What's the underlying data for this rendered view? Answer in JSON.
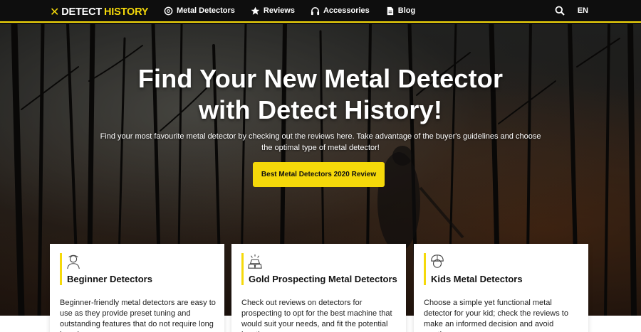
{
  "nav": {
    "logo_word1": "DETECT",
    "logo_word2": "HISTORY",
    "items": [
      {
        "label": "Metal Detectors",
        "icon": "metal-detector-icon"
      },
      {
        "label": "Reviews",
        "icon": "star-icon"
      },
      {
        "label": "Accessories",
        "icon": "headphones-icon"
      },
      {
        "label": "Blog",
        "icon": "document-icon"
      }
    ],
    "lang": "EN",
    "accent": "#f5d90a"
  },
  "hero": {
    "title_line1": "Find Your New Metal Detector",
    "title_line2": "with Detect History!",
    "subtitle": "Find your most favourite metal detector by checking out the reviews here. Take advantage of the buyer's guidelines and choose the optimal type of metal detector!",
    "cta": "Best Metal Detectors 2020 Review"
  },
  "cards": [
    {
      "title": "Beginner Detectors",
      "icon": "beginner-person-icon",
      "text": "Beginner-friendly metal detectors are easy to use as they provide preset tuning and outstanding features that do not require long learning."
    },
    {
      "title": "Gold Prospecting Metal Detectors",
      "icon": "gold-bar-icon",
      "text": "Check out reviews on detectors for prospecting to opt for the best machine that would suit your needs, and fit the potential location."
    },
    {
      "title": "Kids Metal Detectors",
      "icon": "kid-helmet-icon",
      "text": "Choose a simple yet functional metal detector for your kid; check the reviews to make an informed decision and avoid wasting money."
    }
  ]
}
